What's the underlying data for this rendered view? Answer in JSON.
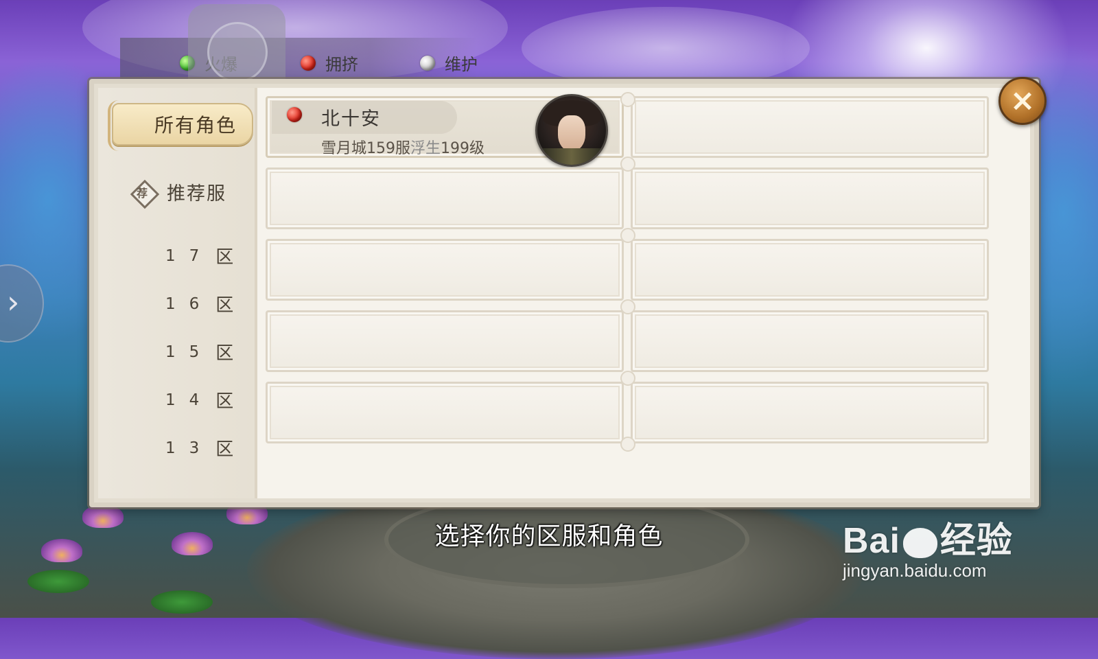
{
  "status_legend": [
    {
      "label": "火爆",
      "color": "#3cb82a"
    },
    {
      "label": "拥挤",
      "color": "#e0261a"
    },
    {
      "label": "维护",
      "color": "#c8c8c8"
    }
  ],
  "sidebar": {
    "tab_all_roles": "所有角色",
    "tab_recommended": "推荐服",
    "recommended_icon_glyph": "荐",
    "zones": [
      {
        "digits": [
          "1",
          "7"
        ],
        "suffix": "区"
      },
      {
        "digits": [
          "1",
          "6"
        ],
        "suffix": "区"
      },
      {
        "digits": [
          "1",
          "5"
        ],
        "suffix": "区"
      },
      {
        "digits": [
          "1",
          "4"
        ],
        "suffix": "区"
      },
      {
        "digits": [
          "1",
          "3"
        ],
        "suffix": "区"
      }
    ]
  },
  "roles": [
    {
      "name": "北十安",
      "server": "雪月城159服",
      "class_name": "浮生",
      "level": "199级",
      "status_color": "#e0261a",
      "avatar": "character-portrait"
    }
  ],
  "close_icon": "×",
  "side_arrow_icon": "›",
  "subtitle": "选择你的区服和角色",
  "watermark": {
    "brand_left": "Bai",
    "brand_right": "经验",
    "url": "jingyan.baidu.com"
  }
}
